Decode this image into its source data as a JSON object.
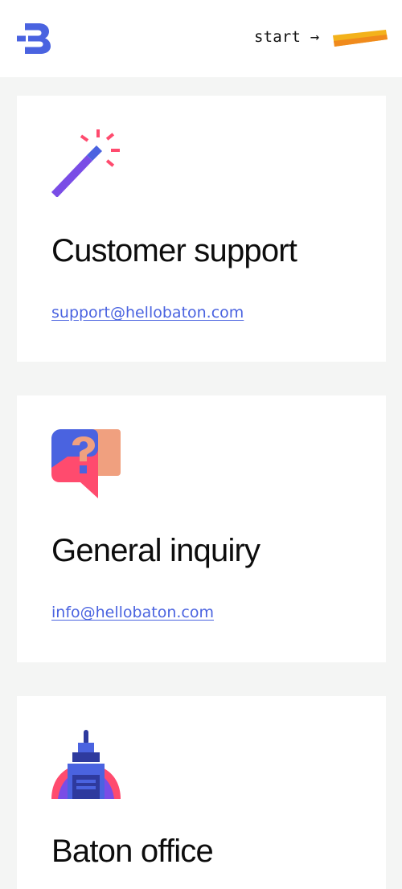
{
  "header": {
    "logo_name": "baton-logo",
    "start_label": "start →",
    "colors": {
      "brand_blue": "#4a63e0",
      "swatch_yellow": "#f3b21b",
      "swatch_orange": "#f08a1c"
    }
  },
  "cards": [
    {
      "icon": "magic-wand-icon",
      "title": "Customer support",
      "link": "support@hellobaton.com"
    },
    {
      "icon": "question-chat-icon",
      "title": "General inquiry",
      "link": "info@hellobaton.com"
    },
    {
      "icon": "office-building-icon",
      "title": "Baton office"
    }
  ]
}
